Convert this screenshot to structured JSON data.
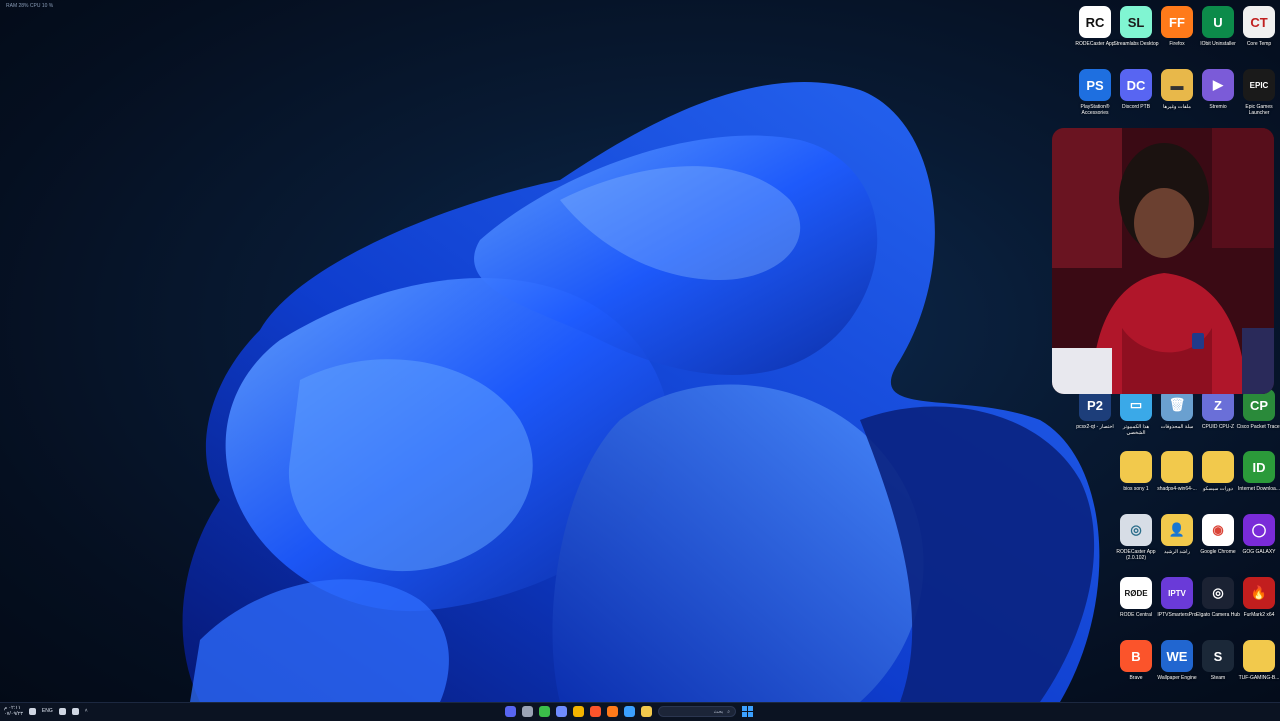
{
  "system_overlay": {
    "perf_text": "RAM 28%   CPU 10 %"
  },
  "desktop_icons": [
    {
      "label": "RODECaster App",
      "glyph": "RC",
      "color": "#ffffff",
      "fg": "#111111"
    },
    {
      "label": "Streamlabs Desktop",
      "glyph": "SL",
      "color": "#80f5d2",
      "fg": "#1b1b1b"
    },
    {
      "label": "Firefox",
      "glyph": "FF",
      "color": "#ff7a1a",
      "fg": "#ffffff"
    },
    {
      "label": "IObit Uninstaller",
      "glyph": "U",
      "color": "#0c8b4a",
      "fg": "#ffffff"
    },
    {
      "label": "Core Temp",
      "glyph": "CT",
      "color": "#f0f0f0",
      "fg": "#c02020"
    },
    {
      "label": "PlayStation® Accessories",
      "glyph": "PS",
      "color": "#1e6fe0",
      "fg": "#ffffff"
    },
    {
      "label": "Discord PTB",
      "glyph": "DC",
      "color": "#5865f2",
      "fg": "#ffffff"
    },
    {
      "label": "ملفات وغيرها",
      "glyph": "▬",
      "color": "#e8b84a",
      "fg": "#333333"
    },
    {
      "label": "Stremio",
      "glyph": "▶",
      "color": "#7b5bd8",
      "fg": "#ffffff"
    },
    {
      "label": "Epic Games Launcher",
      "glyph": "EPIC",
      "color": "#1a1a1a",
      "fg": "#ffffff"
    },
    {
      "label": "pcsx2-qt - اختصار",
      "glyph": "P2",
      "color": "#1d3e7a",
      "fg": "#ffffff"
    },
    {
      "label": "هذا الكمبيوتر الشخصي",
      "glyph": "▭",
      "color": "#3aa9e8",
      "fg": "#ffffff"
    },
    {
      "label": "سلة المحذوفات",
      "glyph": "🗑",
      "color": "#6aa0d0",
      "fg": "#ffffff"
    },
    {
      "label": "CPUID CPU-Z",
      "glyph": "Z",
      "color": "#6a6fd8",
      "fg": "#ffffff"
    },
    {
      "label": "Cisco Packet Tracer",
      "glyph": "CP",
      "color": "#2a8a3a",
      "fg": "#ffffff"
    },
    {
      "label": "bios sony 1",
      "glyph": "",
      "color": "#f2c94c",
      "fg": "#333333"
    },
    {
      "label": "shadps4-win64-...",
      "glyph": "",
      "color": "#f2c94c",
      "fg": "#333333"
    },
    {
      "label": "دورات سيسكو",
      "glyph": "",
      "color": "#f2c94c",
      "fg": "#333333"
    },
    {
      "label": "Internet Downloa...",
      "glyph": "ID",
      "color": "#2b9a3a",
      "fg": "#ffffff"
    },
    {
      "label": "RODECaster App (2.0.102)",
      "glyph": "◎",
      "color": "#d7dde6",
      "fg": "#2b6d8a"
    },
    {
      "label": "راشد الرشيد",
      "glyph": "👤",
      "color": "#f2c94c",
      "fg": "#333333"
    },
    {
      "label": "Google Chrome",
      "glyph": "◉",
      "color": "#ffffff",
      "fg": "#db4437"
    },
    {
      "label": "GOG GALAXY",
      "glyph": "◯",
      "color": "#7a2bd8",
      "fg": "#ffffff"
    },
    {
      "label": "RODE Central",
      "glyph": "RØDE",
      "color": "#ffffff",
      "fg": "#111111"
    },
    {
      "label": "IPTVSmartersPro",
      "glyph": "IPTV",
      "color": "#6a3ad8",
      "fg": "#ffffff"
    },
    {
      "label": "Elgato Camera Hub",
      "glyph": "◎",
      "color": "#1b2233",
      "fg": "#ffffff"
    },
    {
      "label": "FurMark2 x64",
      "glyph": "🔥",
      "color": "#c21e1e",
      "fg": "#ffb020"
    },
    {
      "label": "Brave",
      "glyph": "B",
      "color": "#fb542b",
      "fg": "#ffffff"
    },
    {
      "label": "Wallpaper Engine",
      "glyph": "WE",
      "color": "#2166d0",
      "fg": "#ffffff"
    },
    {
      "label": "Steam",
      "glyph": "S",
      "color": "#1b2838",
      "fg": "#ffffff"
    },
    {
      "label": "TUF-GAMING-B...",
      "glyph": "",
      "color": "#f2c94c",
      "fg": "#333333"
    }
  ],
  "taskbar": {
    "clock_time": "٠٢:١١ م",
    "clock_date": "٠٧/٠٩/٢٣",
    "language": "ENG",
    "search_placeholder": "بحث",
    "tray_icons": [
      "wifi-icon",
      "speaker-icon",
      "battery-icon",
      "mic-icon",
      "chevron-up-icon"
    ],
    "pinned_apps": [
      {
        "name": "discord-taskbar-icon",
        "color": "#5865f2"
      },
      {
        "name": "settings-taskbar-icon",
        "color": "#9aa3b5"
      },
      {
        "name": "xbox-taskbar-icon",
        "color": "#3bbf4a"
      },
      {
        "name": "copilot-taskbar-icon",
        "color": "#6f8cff"
      },
      {
        "name": "chrome-taskbar-icon",
        "color": "#f4b400"
      },
      {
        "name": "brave-taskbar-icon",
        "color": "#fb542b"
      },
      {
        "name": "firefox-taskbar-icon",
        "color": "#ff7a1a"
      },
      {
        "name": "store-taskbar-icon",
        "color": "#3ba0ff"
      },
      {
        "name": "explorer-taskbar-icon",
        "color": "#f2c94c"
      }
    ]
  },
  "colors": {
    "accent": "#3ba0ff",
    "wallpaper_bloom": "#1e5bff"
  }
}
